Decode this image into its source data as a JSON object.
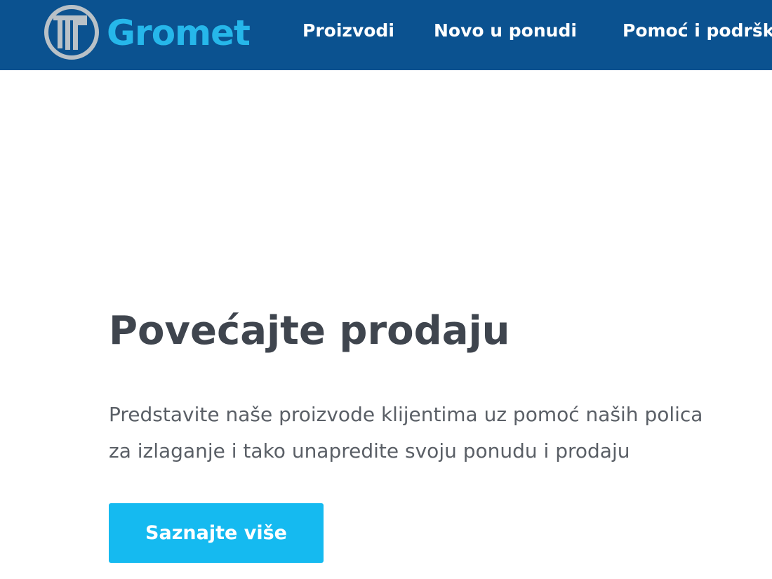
{
  "brand": {
    "name": "Gromet",
    "logo_icon": "gromet-logo-icon",
    "colors": {
      "nav_background": "#0b5290",
      "logo_text": "#26b7ea",
      "logo_ring": "#b9c1c7",
      "button": "#15baf0",
      "title": "#3f454e",
      "body_text": "#5a5f66"
    }
  },
  "nav": {
    "items": [
      {
        "label": "Proizvodi"
      },
      {
        "label": "Novo u ponudi"
      },
      {
        "label": "Pomoć i podršk"
      }
    ]
  },
  "hero": {
    "title": "Povećajte prodaju",
    "text_line1": "Predstavite naše proizvode klijentima uz pomoć naših polica",
    "text_line2": "za izlaganje i tako unapredite svoju ponudu i prodaju",
    "button_label": "Saznajte više"
  }
}
